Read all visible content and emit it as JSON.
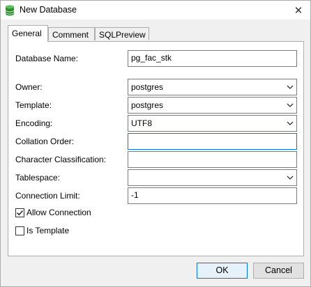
{
  "window": {
    "title": "New Database",
    "close_glyph": "✕"
  },
  "tabs": [
    {
      "label": "General",
      "active": true
    },
    {
      "label": "Comment",
      "active": false
    },
    {
      "label": "SQLPreview",
      "active": false
    }
  ],
  "form": {
    "database_name": {
      "label": "Database Name:",
      "value": "pg_fac_stk"
    },
    "owner": {
      "label": "Owner:",
      "value": "postgres"
    },
    "template": {
      "label": "Template:",
      "value": "postgres"
    },
    "encoding": {
      "label": "Encoding:",
      "value": "UTF8"
    },
    "collation_order": {
      "label": "Collation Order:",
      "value": ""
    },
    "character_classification": {
      "label": "Character Classification:",
      "value": ""
    },
    "tablespace": {
      "label": "Tablespace:",
      "value": ""
    },
    "connection_limit": {
      "label": "Connection Limit:",
      "value": "-1"
    },
    "allow_connection": {
      "label": "Allow Connection",
      "checked": true
    },
    "is_template": {
      "label": "Is Template",
      "checked": false
    }
  },
  "buttons": {
    "ok": "OK",
    "cancel": "Cancel"
  },
  "colors": {
    "focus_border": "#0078d7",
    "icon_green": "#3c9a3c"
  }
}
